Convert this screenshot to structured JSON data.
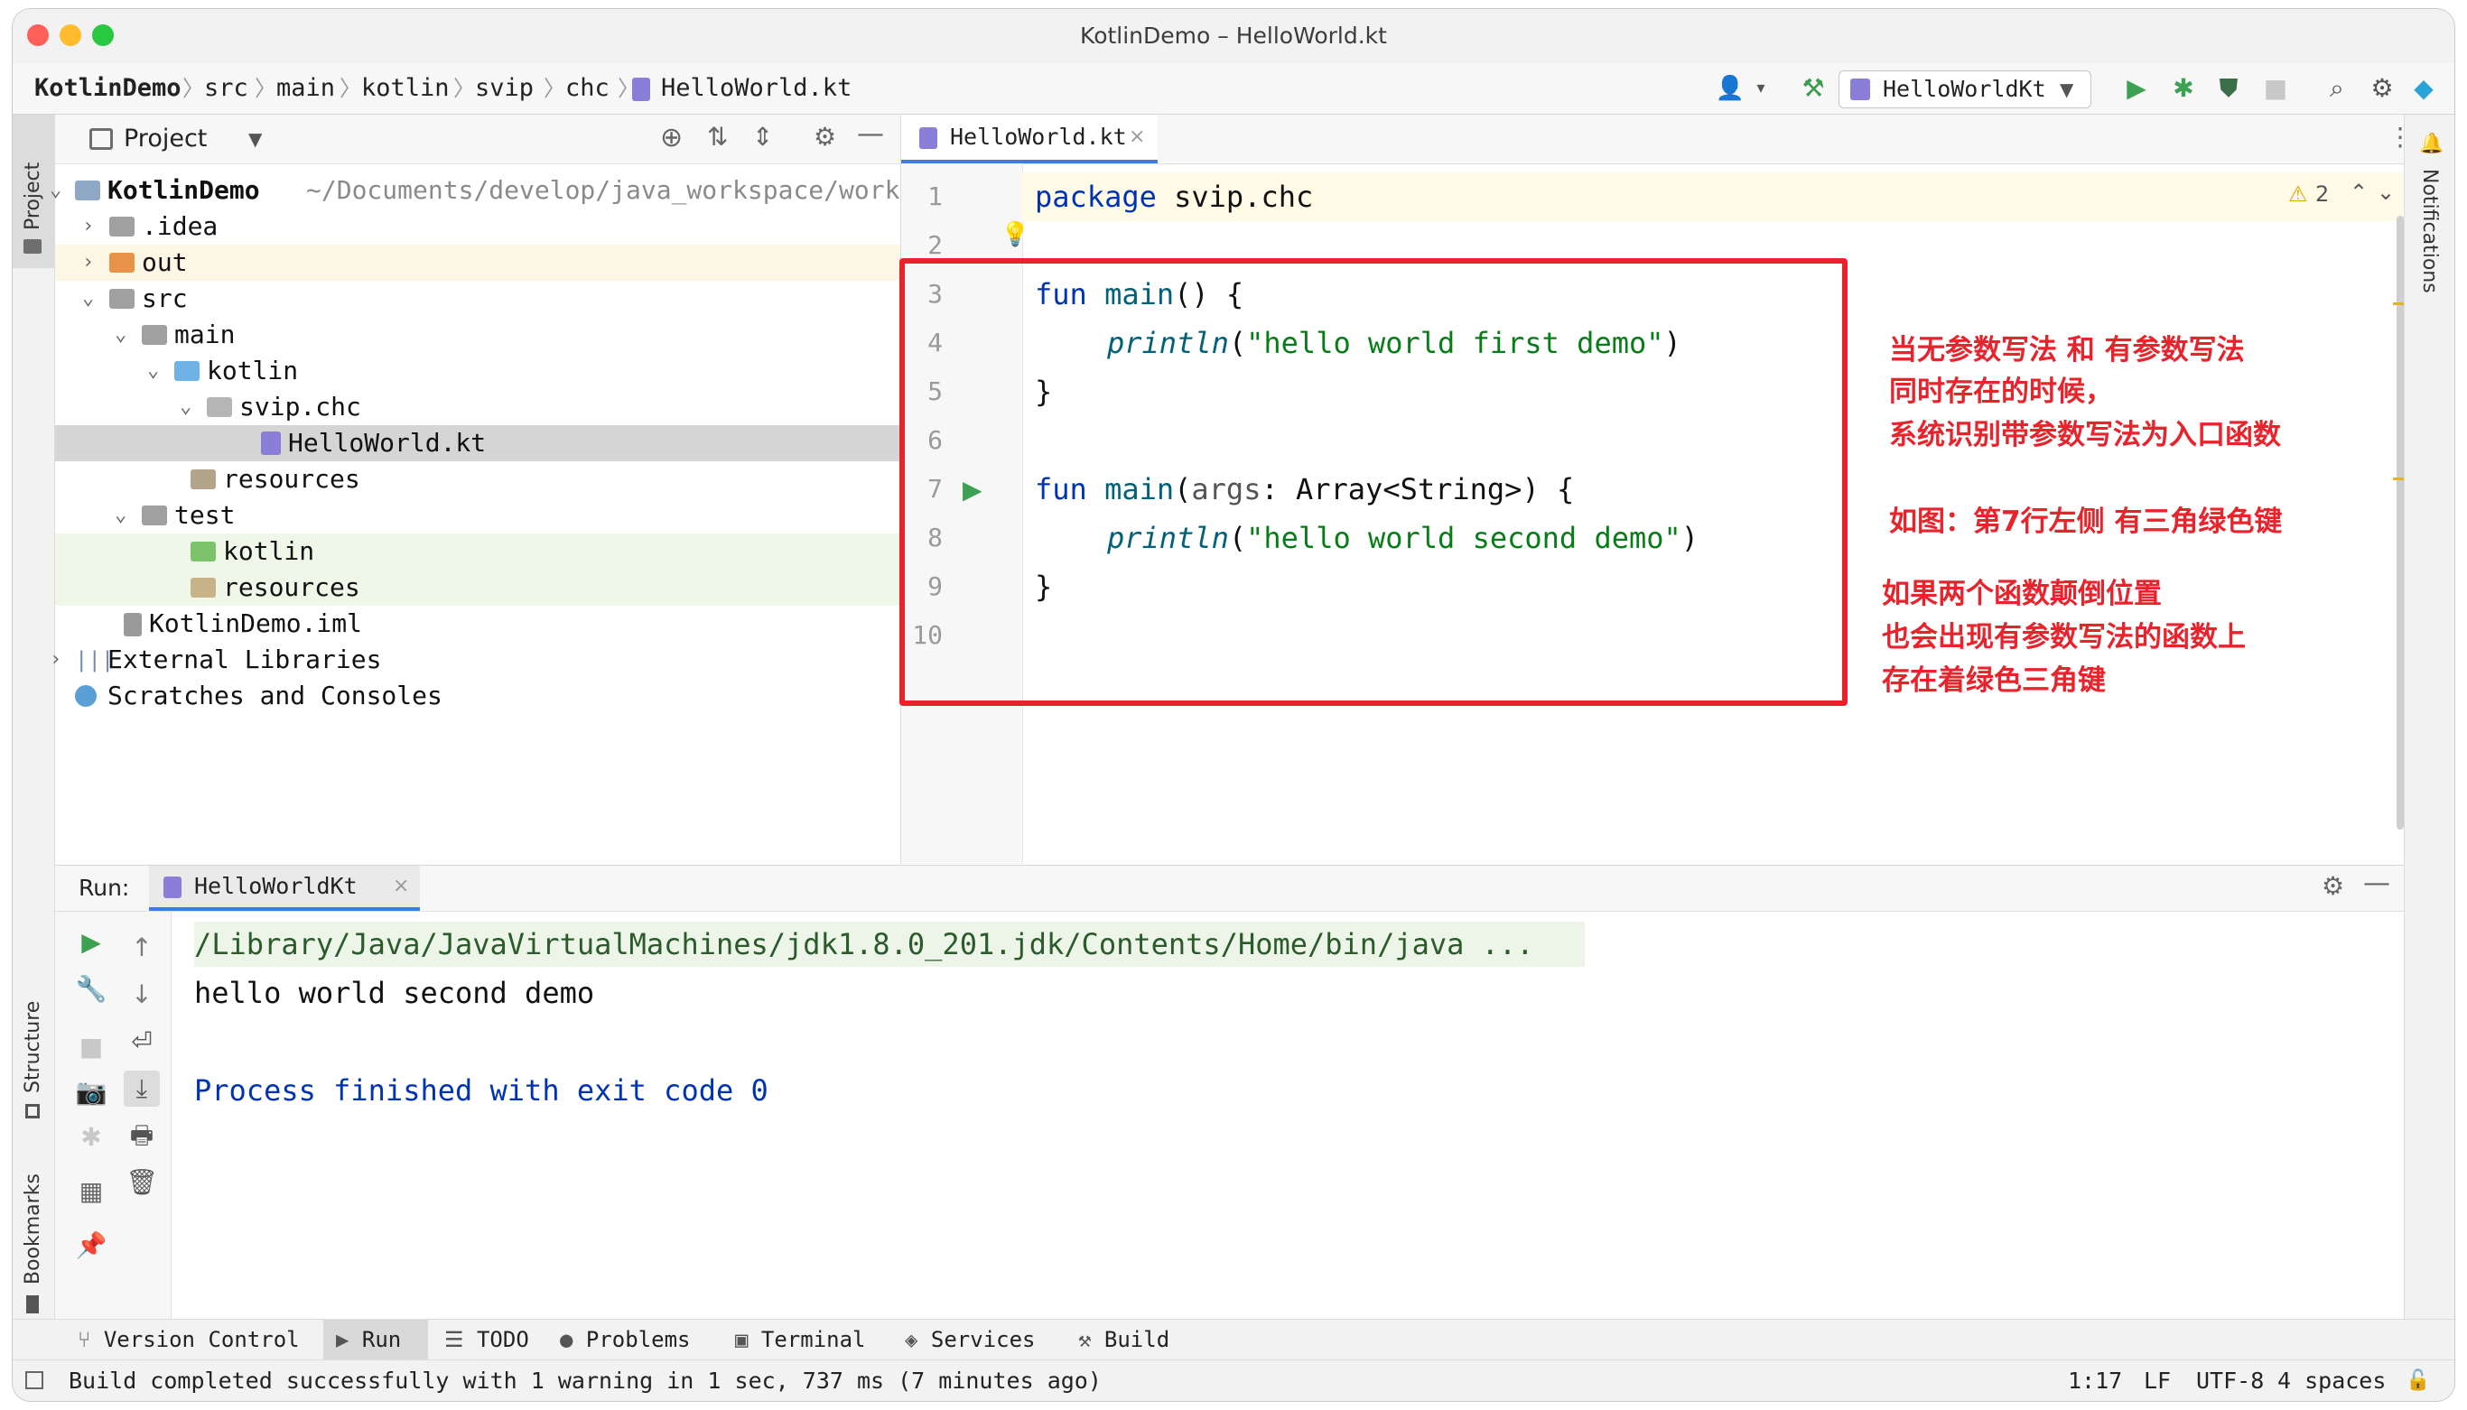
{
  "window": {
    "title": "KotlinDemo – HelloWorld.kt"
  },
  "breadcrumbs": [
    "KotlinDemo",
    "src",
    "main",
    "kotlin",
    "svip",
    "chc",
    "HelloWorld.kt"
  ],
  "run_config": {
    "name": "HelloWorldKt"
  },
  "left_stripe": {
    "project": "Project",
    "structure": "Structure",
    "bookmarks": "Bookmarks"
  },
  "right_stripe": {
    "notifications": "Notifications"
  },
  "project_panel": {
    "title": "Project",
    "tree": [
      {
        "label": "KotlinDemo",
        "path": "~/Documents/develop/java_workspace/work"
      },
      {
        "label": ".idea"
      },
      {
        "label": "out"
      },
      {
        "label": "src"
      },
      {
        "label": "main"
      },
      {
        "label": "kotlin"
      },
      {
        "label": "svip.chc"
      },
      {
        "label": "HelloWorld.kt"
      },
      {
        "label": "resources"
      },
      {
        "label": "test"
      },
      {
        "label": "kotlin"
      },
      {
        "label": "resources"
      },
      {
        "label": "KotlinDemo.iml"
      },
      {
        "label": "External Libraries"
      },
      {
        "label": "Scratches and Consoles"
      }
    ]
  },
  "editor": {
    "tab": "HelloWorld.kt",
    "warnings": "2",
    "line_numbers": [
      "1",
      "2",
      "3",
      "4",
      "5",
      "6",
      "7",
      "8",
      "9",
      "10"
    ],
    "code": {
      "l1_kw": "package",
      "l1_rest": " svip.chc",
      "l3_kw": "fun",
      "l3_fn": " main",
      "l3_rest": "() {",
      "l4_call": "println",
      "l4_open": "(",
      "l4_str": "\"hello world first demo\"",
      "l4_close": ")",
      "l5": "}",
      "l7_kw": "fun",
      "l7_fn": " main",
      "l7_open": "(",
      "l7_param": "args",
      "l7_rest": ": Array<String>) {",
      "l8_call": "println",
      "l8_open": "(",
      "l8_str": "\"hello world second demo\"",
      "l8_close": ")",
      "l9": "}"
    }
  },
  "annotations": {
    "n1": "当无参数写法 和 有参数写法",
    "n2": "同时存在的时候，",
    "n3": "系统识别带参数写法为入口函数",
    "n4": "如图：第7行左侧 有三角绿色键",
    "n5": "如果两个函数颠倒位置",
    "n6": "也会出现有参数写法的函数上",
    "n7": "存在着绿色三角键"
  },
  "run_panel": {
    "label": "Run:",
    "tab": "HelloWorldKt",
    "output": [
      "/Library/Java/JavaVirtualMachines/jdk1.8.0_201.jdk/Contents/Home/bin/java ...",
      "hello world second demo",
      "Process finished with exit code 0"
    ]
  },
  "bottom_tabs": [
    "Version Control",
    "Run",
    "TODO",
    "Problems",
    "Terminal",
    "Services",
    "Build"
  ],
  "status": {
    "message": "Build completed successfully with 1 warning in 1 sec, 737 ms (7 minutes ago)",
    "position": "1:17",
    "line_sep": "LF",
    "encoding": "UTF-8",
    "indent": "4 spaces"
  },
  "colors": {
    "annotation_red": "#e8232b",
    "keyword_blue": "#0033b3",
    "string_green": "#067d17",
    "run_green": "#3da153"
  }
}
